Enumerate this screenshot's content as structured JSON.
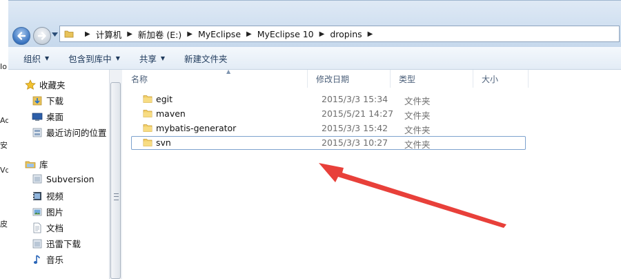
{
  "window": {
    "address_path": [
      "计算机",
      "新加卷 (E:)",
      "MyEclipse",
      "MyEclipse 10",
      "dropins"
    ]
  },
  "toolbar": {
    "organize": "组织",
    "include_in_library": "包含到库中",
    "share": "共享",
    "new_folder": "新建文件夹"
  },
  "navpane": {
    "favorites_label": "收藏夹",
    "favorites": [
      "下载",
      "桌面",
      "最近访问的位置"
    ],
    "libraries_label": "库",
    "libraries": [
      "Subversion",
      "视频",
      "图片",
      "文档",
      "迅雷下载",
      "音乐"
    ]
  },
  "columns": {
    "name": "名称",
    "modified": "修改日期",
    "type": "类型",
    "size": "大小"
  },
  "files": [
    {
      "name": "egit",
      "modified": "2015/3/3 15:34",
      "type": "文件夹"
    },
    {
      "name": "maven",
      "modified": "2015/5/21 14:27",
      "type": "文件夹"
    },
    {
      "name": "mybatis-generator",
      "modified": "2015/3/3 15:42",
      "type": "文件夹"
    },
    {
      "name": "svn",
      "modified": "2015/3/3 10:27",
      "type": "文件夹"
    }
  ],
  "underlay_fragments": [
    "Io",
    "Aq",
    "安",
    "Vd",
    "皮"
  ],
  "colors": {
    "annotation_arrow": "#e8403a",
    "selection_border": "#7da2ce"
  }
}
